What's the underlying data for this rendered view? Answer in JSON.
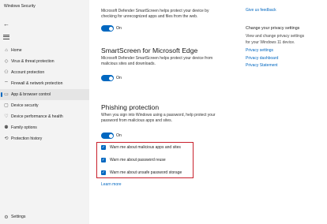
{
  "window": {
    "title": "Windows Security"
  },
  "sidebar": {
    "items": [
      {
        "label": "Home",
        "icon": "home-icon",
        "glyph": "⌂"
      },
      {
        "label": "Virus & threat protection",
        "icon": "shield-icon",
        "glyph": "◇"
      },
      {
        "label": "Account protection",
        "icon": "person-icon",
        "glyph": "⚇"
      },
      {
        "label": "Firewall & network protection",
        "icon": "wifi-icon",
        "glyph": "⌔"
      },
      {
        "label": "App & browser control",
        "icon": "app-window-icon",
        "glyph": "▭"
      },
      {
        "label": "Device security",
        "icon": "device-icon",
        "glyph": "▢"
      },
      {
        "label": "Device performance & health",
        "icon": "heart-icon",
        "glyph": "♡"
      },
      {
        "label": "Family options",
        "icon": "family-icon",
        "glyph": "⚉"
      },
      {
        "label": "Protection history",
        "icon": "history-icon",
        "glyph": "⟲"
      }
    ],
    "active_index": 4,
    "settings_label": "Settings"
  },
  "main": {
    "intro": {
      "line1": "Microsoft Defender SmartScreen helps protect your device by",
      "line2": "checking for unrecognized apps and files from the web.",
      "toggle_label": "On"
    },
    "edge": {
      "heading": "SmartScreen for Microsoft Edge",
      "line1": "Microsoft Defender SmartScreen helps protect your device from",
      "line2": "malicious sites and downloads.",
      "toggle_label": "On"
    },
    "phishing": {
      "heading": "Phishing protection",
      "line1": "When you sign into Windows using a password, help protect your",
      "line2": "password from malicious apps and sites.",
      "toggle_label": "On",
      "options": [
        "Warn me about malicious apps and sites",
        "Warn me about password reuse",
        "Warn me about unsafe password storage"
      ],
      "learn_more": "Learn more"
    }
  },
  "right": {
    "feedback_link": "Give us feedback",
    "privacy_heading": "Change your privacy settings",
    "privacy_line1": "View and change privacy settings",
    "privacy_line2": "for your Windows 11 device.",
    "links": [
      "Privacy settings",
      "Privacy dashboard",
      "Privacy Statement"
    ]
  },
  "colors": {
    "accent": "#0067c0",
    "highlight_border": "#c8202c"
  }
}
